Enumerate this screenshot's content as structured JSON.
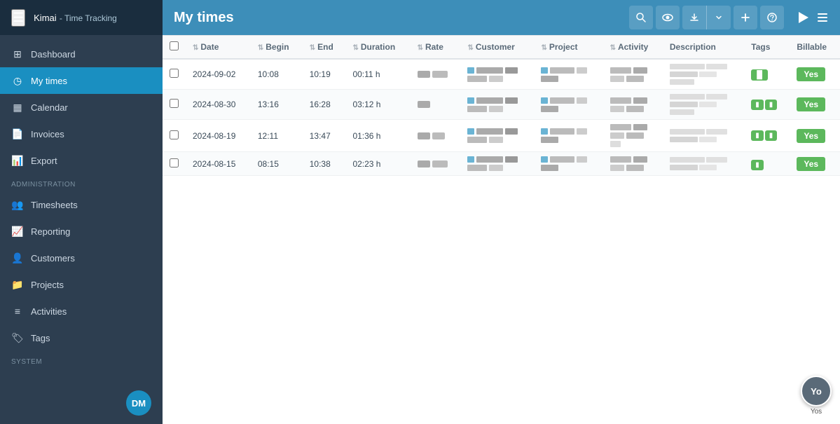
{
  "app": {
    "logo": "Kimai",
    "subtitle": "- Time Tracking"
  },
  "sidebar": {
    "menu_icon": "☰",
    "items": [
      {
        "id": "dashboard",
        "label": "Dashboard",
        "icon": "⊞",
        "active": false
      },
      {
        "id": "my-times",
        "label": "My times",
        "icon": "◷",
        "active": true
      },
      {
        "id": "calendar",
        "label": "Calendar",
        "icon": "📅",
        "active": false
      },
      {
        "id": "invoices",
        "label": "Invoices",
        "icon": "📄",
        "active": false
      },
      {
        "id": "export",
        "label": "Export",
        "icon": "📊",
        "active": false
      }
    ],
    "admin_section": "Administration",
    "admin_items": [
      {
        "id": "timesheets",
        "label": "Timesheets",
        "icon": "👥",
        "active": false
      },
      {
        "id": "reporting",
        "label": "Reporting",
        "icon": "📈",
        "active": false
      },
      {
        "id": "customers",
        "label": "Customers",
        "icon": "👤",
        "active": false
      },
      {
        "id": "projects",
        "label": "Projects",
        "icon": "📁",
        "active": false
      },
      {
        "id": "activities",
        "label": "Activities",
        "icon": "≡",
        "active": false
      },
      {
        "id": "tags",
        "label": "Tags",
        "icon": "🏷",
        "active": false
      }
    ],
    "system_section": "System",
    "avatar": {
      "initials": "DM"
    },
    "user_avatar": "Yos"
  },
  "page": {
    "title": "My times",
    "breadcrumb": "My times"
  },
  "toolbar": {
    "search_title": "Search",
    "visibility_title": "Toggle columns",
    "download_title": "Download",
    "add_title": "Add",
    "help_title": "Help"
  },
  "table": {
    "columns": [
      {
        "id": "date",
        "label": "Date",
        "sortable": true
      },
      {
        "id": "begin",
        "label": "Begin",
        "sortable": true
      },
      {
        "id": "end",
        "label": "End",
        "sortable": true
      },
      {
        "id": "duration",
        "label": "Duration",
        "sortable": true
      },
      {
        "id": "rate",
        "label": "Rate",
        "sortable": true
      },
      {
        "id": "customer",
        "label": "Customer",
        "sortable": true
      },
      {
        "id": "project",
        "label": "Project",
        "sortable": true
      },
      {
        "id": "activity",
        "label": "Activity",
        "sortable": true
      },
      {
        "id": "description",
        "label": "Description",
        "sortable": false
      },
      {
        "id": "tags",
        "label": "Tags",
        "sortable": false
      },
      {
        "id": "billable",
        "label": "Billable",
        "sortable": false
      }
    ],
    "rows": [
      {
        "date": "2024-09-02",
        "begin": "10:08",
        "end": "10:19",
        "duration": "00:11 h",
        "rate": "",
        "customer": "",
        "project": "",
        "activity": "",
        "description": "",
        "tags": [
          "tag1"
        ],
        "billable": "Yes"
      },
      {
        "date": "2024-08-30",
        "begin": "13:16",
        "end": "16:28",
        "duration": "03:12 h",
        "rate": "",
        "customer": "",
        "project": "",
        "activity": "",
        "description": "",
        "tags": [
          "tag2",
          "tag3"
        ],
        "billable": "Yes"
      },
      {
        "date": "2024-08-19",
        "begin": "12:11",
        "end": "13:47",
        "duration": "01:36 h",
        "rate": "",
        "customer": "",
        "project": "",
        "activity": "",
        "description": "",
        "tags": [
          "tag4",
          "tag5"
        ],
        "billable": "Yes"
      },
      {
        "date": "2024-08-15",
        "begin": "08:15",
        "end": "10:38",
        "duration": "02:23 h",
        "rate": "",
        "customer": "",
        "project": "",
        "activity": "",
        "description": "",
        "tags": [
          "tag6"
        ],
        "billable": "Yes"
      }
    ]
  }
}
